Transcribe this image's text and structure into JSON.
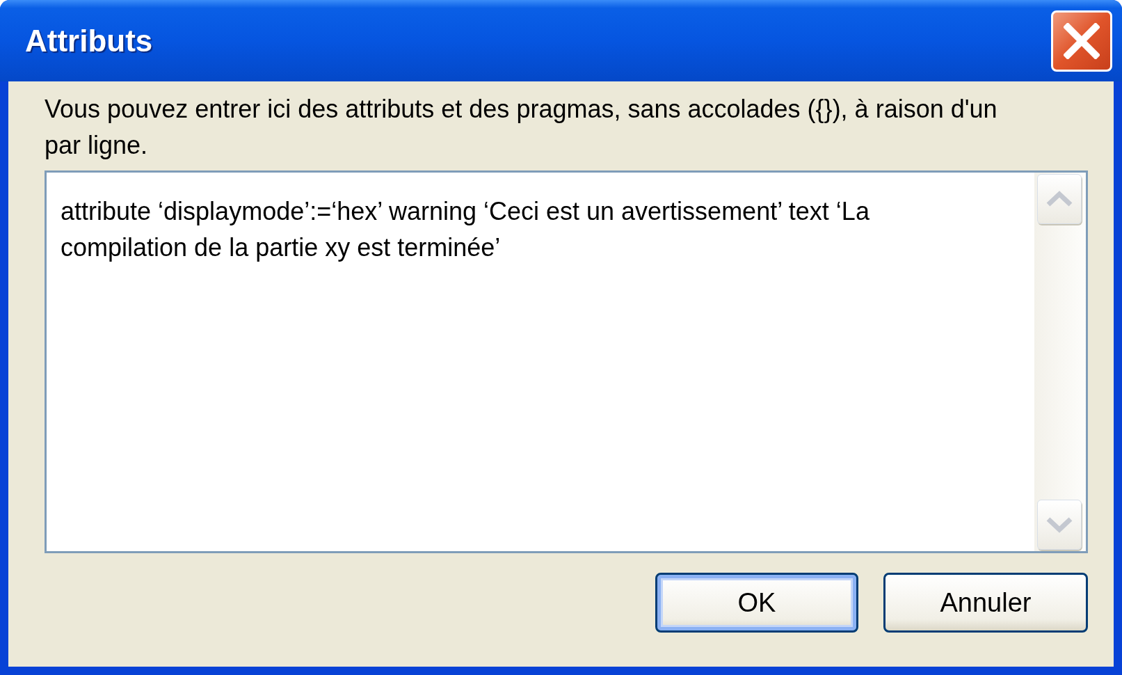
{
  "window": {
    "title": "Attributs"
  },
  "description": "Vous pouvez entrer ici des attributs et des pragmas, sans accolades ({}), à raison d'un par ligne.",
  "editor": {
    "value": "attribute ‘displaymode’:=‘hex’ warning ‘Ceci est un avertissement’ text ‘La compilation de la partie xy est terminée’"
  },
  "buttons": [
    {
      "label": "OK",
      "default": true
    },
    {
      "label": "Annuler",
      "default": false
    }
  ]
}
